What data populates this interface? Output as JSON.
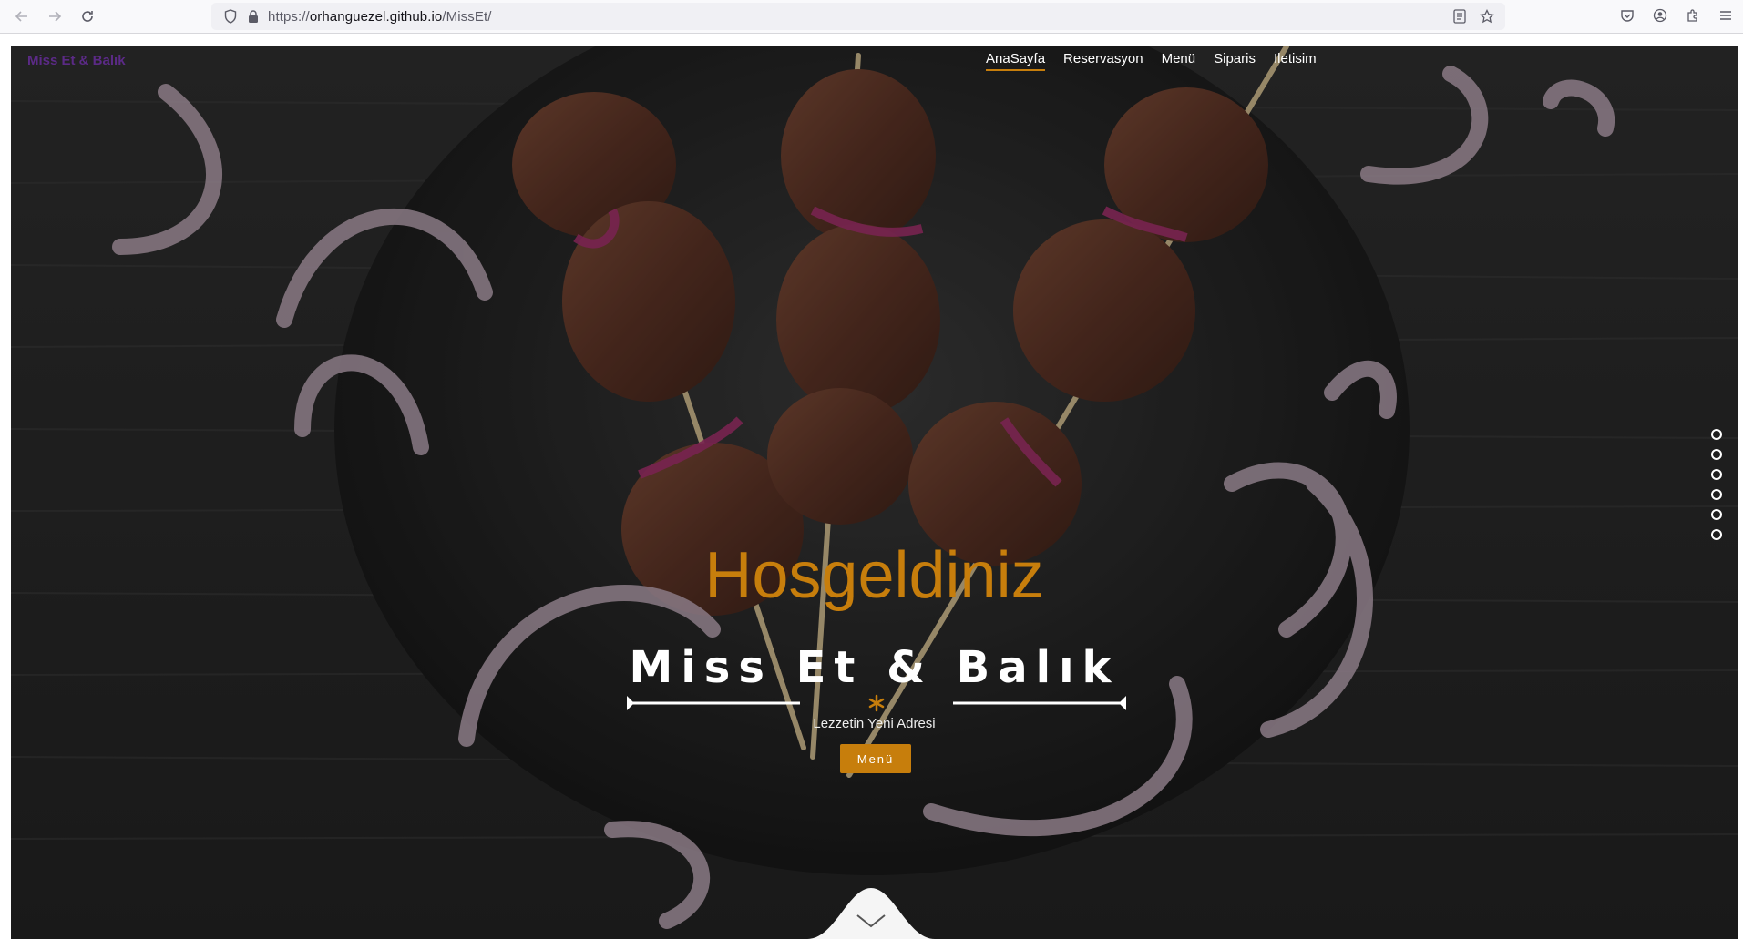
{
  "browser": {
    "url_scheme": "https://",
    "url_host": "orhanguezel.github.io",
    "url_path": "/MissEt/"
  },
  "site": {
    "brand": "Miss Et & Balık",
    "nav": [
      {
        "label": "AnaSayfa",
        "active": true
      },
      {
        "label": "Reservasyon",
        "active": false
      },
      {
        "label": "Menü",
        "active": false
      },
      {
        "label": "Siparis",
        "active": false
      },
      {
        "label": "Iletisim",
        "active": false
      }
    ]
  },
  "hero": {
    "welcome": "Hosgeldiniz",
    "title": "Miss Et & Balık",
    "subtitle": "Lezzetin Yeni Adresi",
    "menu_button": "Menü",
    "slide_count": 6
  },
  "colors": {
    "accent": "#c77e0c",
    "brand": "#5b2a86"
  }
}
